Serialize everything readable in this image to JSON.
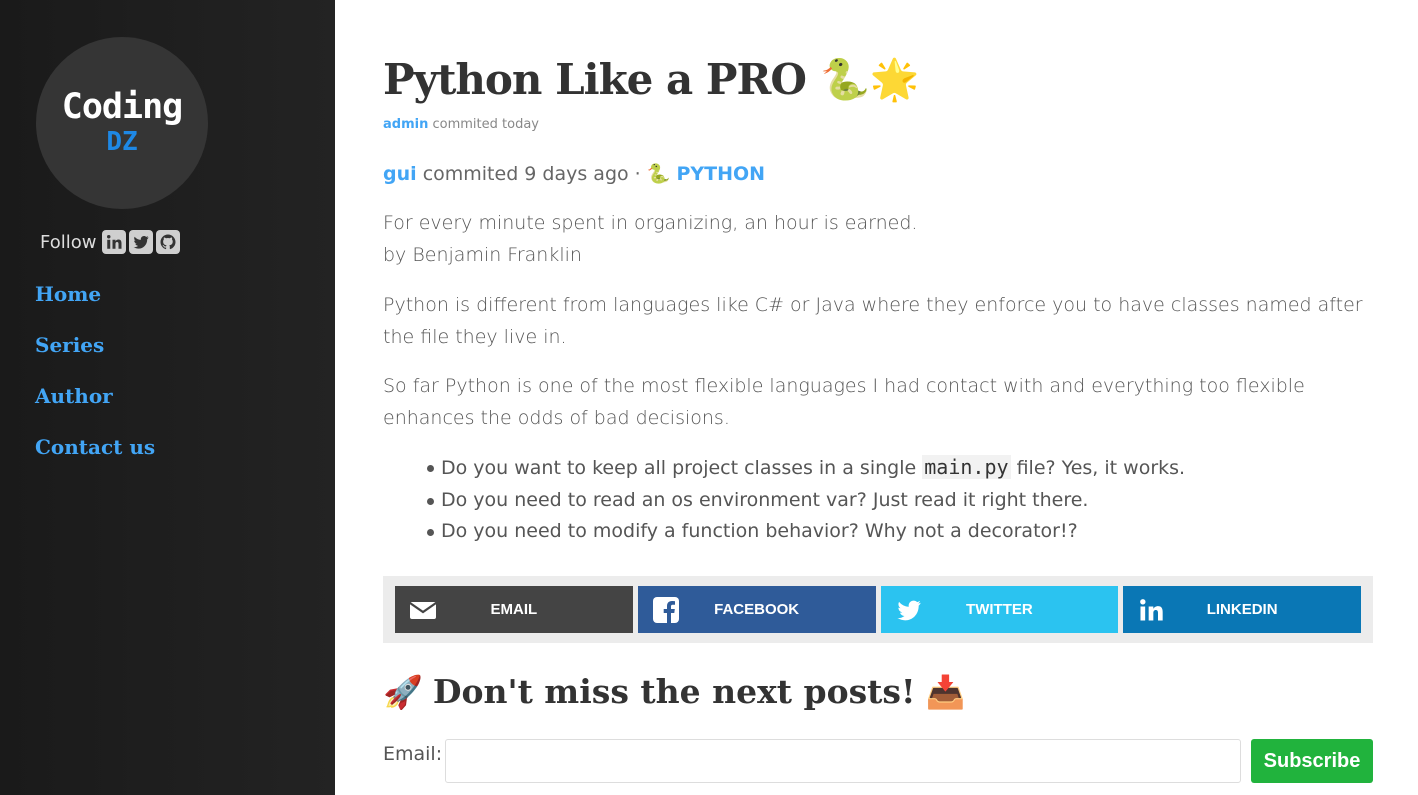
{
  "sidebar": {
    "logo_line1": "Coding",
    "logo_line2": "DZ",
    "follow_label": "Follow",
    "social_icons": [
      "linkedin-icon",
      "twitter-icon",
      "github-icon"
    ],
    "nav": [
      {
        "label": "Home"
      },
      {
        "label": "Series"
      },
      {
        "label": "Author"
      },
      {
        "label": "Contact us"
      }
    ]
  },
  "post": {
    "title": "Python Like a PRO",
    "title_emoji": "🐍🌟",
    "byline_author": "admin",
    "byline_rest": "commited",
    "byline_when": "today",
    "meta_user": "gui",
    "meta_text": "commited 9 days ago ·",
    "meta_tag_emoji": "🐍",
    "meta_tag": "PYTHON",
    "quote_line1": "For every minute spent in organizing, an hour is earned.",
    "quote_line2": "by Benjamin Franklin",
    "para1": "Python is different from languages like C# or Java where they enforce you to have classes named after the file they live in.",
    "para2": "So far Python is one of the most flexible languages I had contact with and everything too flexible enhances the odds of bad decisions.",
    "bullet1_pre": "Do you want to keep all project classes in a single ",
    "bullet1_code": "main.py",
    "bullet1_post": " file? Yes, it works.",
    "bullet2": "Do you need to read an os environment var? Just read it right there.",
    "bullet3": "Do you need to modify a function behavior? Why not a decorator!?"
  },
  "share": {
    "email": "EMAIL",
    "facebook": "FACEBOOK",
    "twitter": "TWITTER",
    "linkedin": "LINKEDIN"
  },
  "subscribe": {
    "emoji_left": "🚀",
    "title": "Don't miss the next posts!",
    "emoji_right": "📥",
    "email_label": "Email:",
    "email_value": "",
    "button": "Subscribe"
  },
  "colors": {
    "sidebar_bg": "#1e1e1e",
    "link_blue": "#42a5f5",
    "email_btn": "#444444",
    "facebook_btn": "#2f5b99",
    "twitter_btn": "#2bc3f0",
    "linkedin_btn": "#0a77b5",
    "subscribe_btn": "#21b33d"
  }
}
